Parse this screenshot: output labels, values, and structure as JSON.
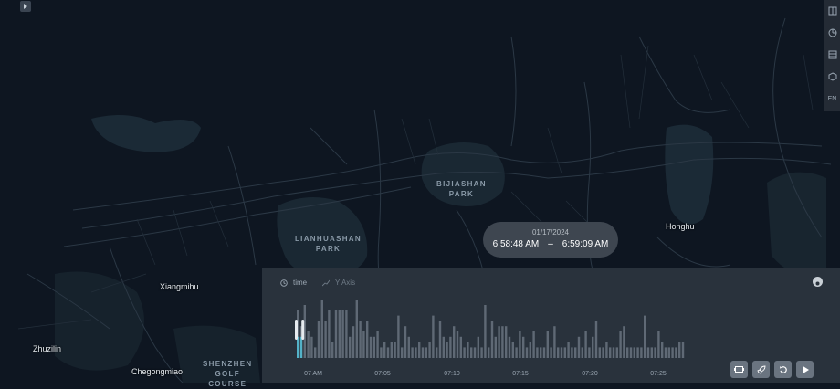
{
  "map": {
    "place_labels": [
      {
        "text": "Honghu",
        "key": "honghu"
      },
      {
        "text": "Xiangmihu",
        "key": "xiangmihu"
      },
      {
        "text": "Zhuzilin",
        "key": "zhuzilin"
      },
      {
        "text": "Chegongmiao",
        "key": "chegongmiao"
      }
    ],
    "park_labels": [
      {
        "text": "BIJIASHAN\nPARK",
        "key": "bijiashan"
      },
      {
        "text": "LIANHUASHAN\nPARK",
        "key": "lianhuashan"
      },
      {
        "text": "SHENZHEN\nGOLF\nCOURSE",
        "key": "golf"
      }
    ]
  },
  "side_toolbar": {
    "items": [
      {
        "icon": "layer-icon"
      },
      {
        "icon": "pie-chart-icon"
      },
      {
        "icon": "table-icon"
      },
      {
        "icon": "cube-icon"
      },
      {
        "icon": "language-icon",
        "label": "EN"
      }
    ]
  },
  "time_display": {
    "date": "01/17/2024",
    "start": "6:58:48 AM",
    "separator": "–",
    "end": "6:59:09 AM"
  },
  "timeline": {
    "tabs": [
      {
        "label": "time",
        "icon": "clock-icon"
      },
      {
        "label": "Y Axis",
        "icon": "line-chart-icon"
      }
    ],
    "tick_labels": [
      "07 AM",
      "07:05",
      "07:10",
      "07:15",
      "07:20",
      "07:25"
    ],
    "controls": [
      "frame-icon",
      "rocket-icon",
      "loop-icon",
      "play-icon"
    ]
  },
  "chart_data": {
    "type": "bar",
    "x_ticks": [
      "07 AM",
      "07:05",
      "07:10",
      "07:15",
      "07:20",
      "07:25"
    ],
    "values": [
      9,
      6,
      10,
      5,
      4,
      2,
      7,
      11,
      7,
      9,
      3,
      9,
      9,
      9,
      9,
      4,
      6,
      11,
      7,
      5,
      7,
      4,
      4,
      5,
      2,
      3,
      2,
      3,
      3,
      8,
      2,
      6,
      4,
      2,
      2,
      3,
      2,
      2,
      3,
      8,
      2,
      7,
      4,
      3,
      4,
      6,
      5,
      4,
      2,
      3,
      2,
      2,
      4,
      2,
      10,
      2,
      7,
      4,
      6,
      6,
      6,
      4,
      3,
      2,
      5,
      4,
      2,
      3,
      5,
      2,
      2,
      2,
      5,
      2,
      6,
      2,
      2,
      2,
      3,
      2,
      2,
      4,
      2,
      5,
      2,
      4,
      7,
      2,
      2,
      3,
      2,
      2,
      2,
      5,
      6,
      2,
      2,
      2,
      2,
      2,
      8,
      2,
      2,
      2,
      5,
      3,
      2,
      2,
      2,
      2,
      3,
      3
    ],
    "selected_range": [
      0,
      1
    ],
    "highlight_values": [
      4,
      4
    ]
  }
}
